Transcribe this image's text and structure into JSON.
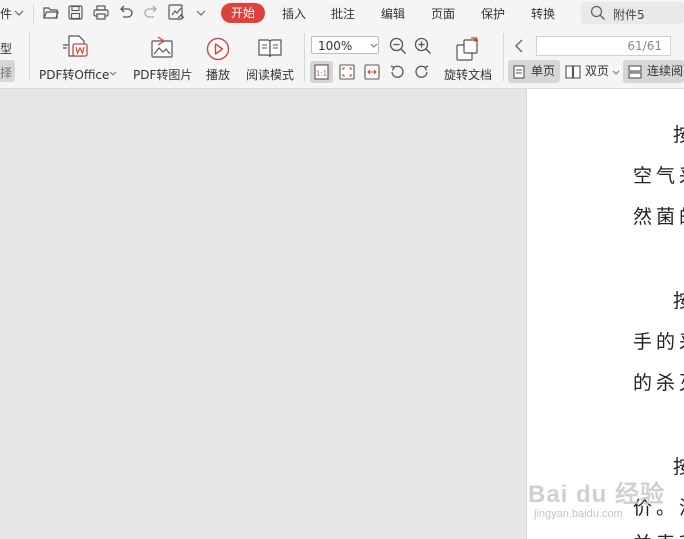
{
  "menubar": {
    "file_partial": "件",
    "items": [
      {
        "id": "start",
        "label": "开始",
        "active": true
      },
      {
        "id": "insert",
        "label": "插入"
      },
      {
        "id": "annotate",
        "label": "批注"
      },
      {
        "id": "edit",
        "label": "编辑"
      },
      {
        "id": "page",
        "label": "页面"
      },
      {
        "id": "protect",
        "label": "保护"
      },
      {
        "id": "convert",
        "label": "转换"
      }
    ],
    "search_text": "附件5",
    "accent_color": "#e0413a"
  },
  "ribbon": {
    "left_partial_top": "型",
    "left_partial_bottom": "择",
    "pdf_to_office": "PDF转Office",
    "pdf_to_image": "PDF转图片",
    "play": "播放",
    "read_mode": "阅读模式",
    "zoom": "100%",
    "rotate_doc": "旋转文档",
    "page_indicator": "61/61",
    "single_page": "单页",
    "double_page": "双页",
    "continuous": "连续阅"
  },
  "document": {
    "lines": [
      "按",
      "空气采",
      "然菌的",
      "按",
      "手的采",
      "的杀灭",
      "按",
      "价。消",
      "并表利"
    ]
  },
  "watermark": {
    "main": "Bai du 经验",
    "sub": "jingyan.baidu.com"
  }
}
